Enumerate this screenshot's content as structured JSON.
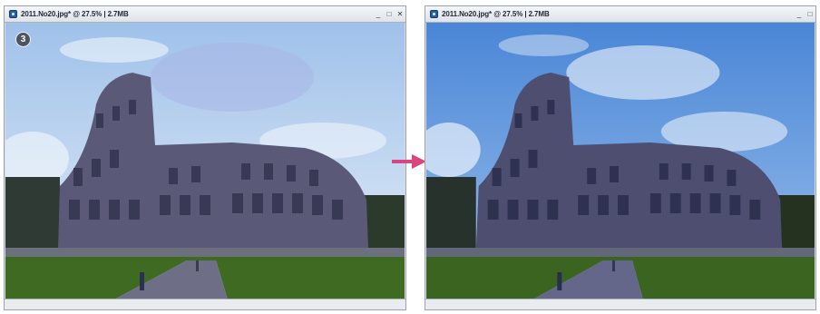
{
  "left_window": {
    "title": "2011.No20.jpg* @ 27.5% | 2.7MB",
    "status": "",
    "step_badge": "3"
  },
  "right_window": {
    "title": "2011.No20.jpg* @ 27.5% | 2.7MB",
    "status": ""
  },
  "window_controls": {
    "minimize": "_",
    "maximize": "□",
    "close": "✕"
  },
  "colors": {
    "arrow": "#d9457f",
    "sky_before": "#b9d3ef",
    "sky_after": "#5e93d8",
    "grass": "#3e6a22",
    "stone": "#5a5a78"
  },
  "icons": [
    "app-icon",
    "minimize-icon",
    "maximize-icon",
    "close-icon",
    "right-arrow-icon"
  ]
}
